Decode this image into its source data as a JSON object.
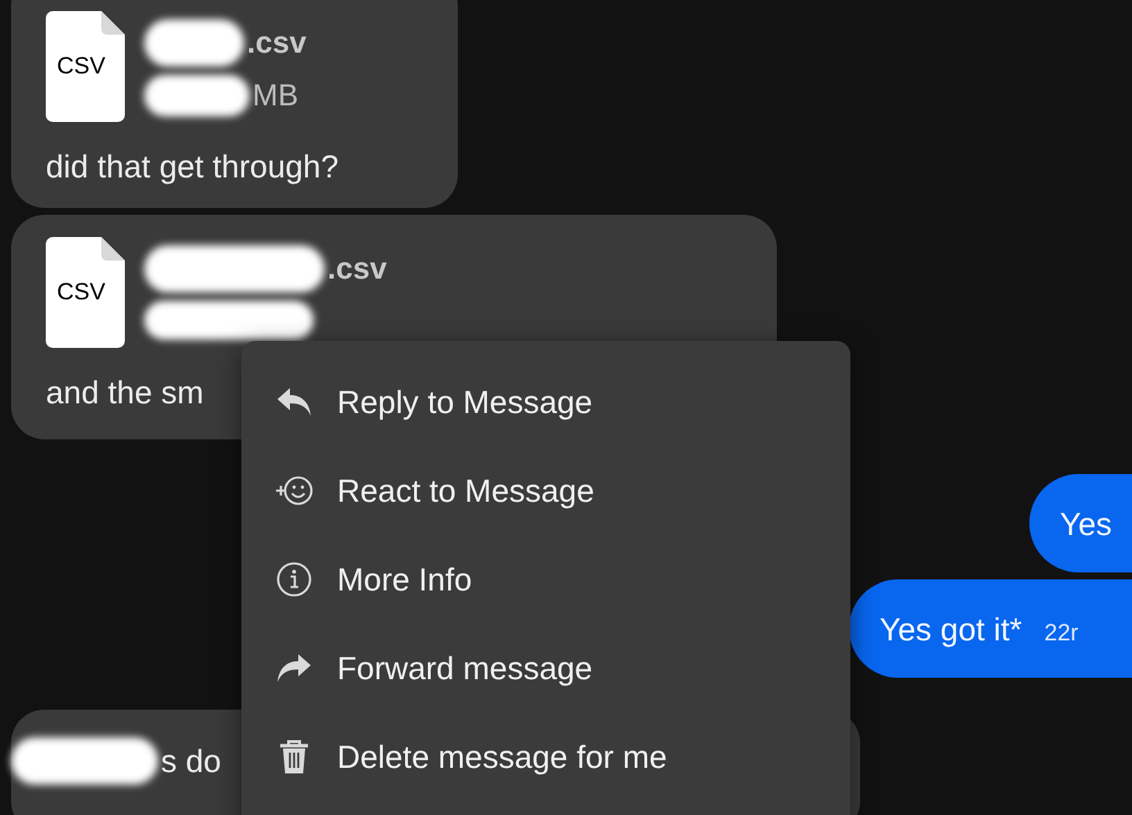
{
  "messages": [
    {
      "kind": "incoming",
      "file": {
        "type_label": "CSV",
        "name": ".csv",
        "size": "MB"
      },
      "text": "did that get through?"
    },
    {
      "kind": "incoming",
      "file": {
        "type_label": "CSV",
        "name": ".csv"
      },
      "text": "and the sm"
    },
    {
      "kind": "outgoing",
      "text": "Yes"
    },
    {
      "kind": "outgoing",
      "text": "Yes got it*",
      "time": "22r"
    },
    {
      "kind": "incoming",
      "text": "s do"
    }
  ],
  "context_menu": {
    "items": [
      {
        "label": "Reply to Message"
      },
      {
        "label": "React to Message"
      },
      {
        "label": "More Info"
      },
      {
        "label": "Forward message"
      },
      {
        "label": "Delete message for me"
      }
    ]
  }
}
